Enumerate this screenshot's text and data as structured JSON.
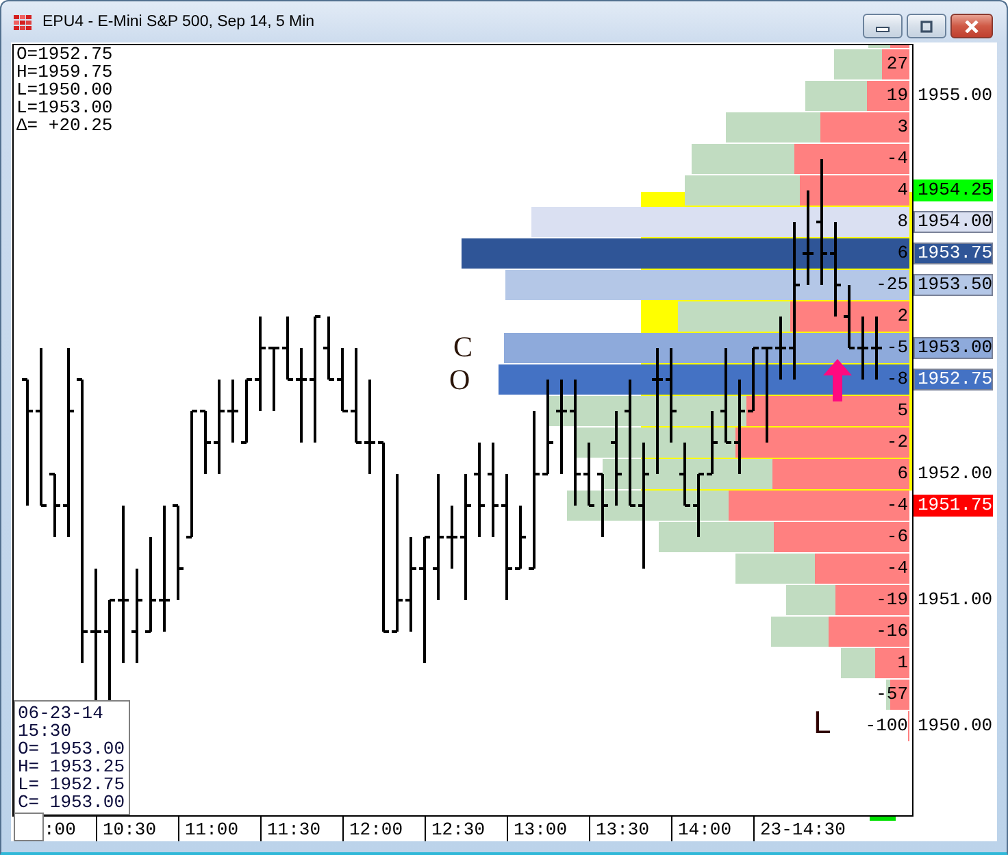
{
  "window": {
    "title": "EPU4 - E-Mini S&P 500, Sep 14, 5 Min"
  },
  "summary": [
    "O=1952.75",
    "H=1959.75",
    "L=1950.00",
    "L=1953.00",
    "Δ= +20.25"
  ],
  "ladder": [
    {
      "kind": "plain"
    },
    {
      "kind": "plain",
      "delta": "27"
    },
    {
      "kind": "plain",
      "delta": "19",
      "price": "1955.00"
    },
    {
      "kind": "plain",
      "delta": "3"
    },
    {
      "kind": "plain",
      "delta": "-4"
    },
    {
      "kind": "marker",
      "delta": "4",
      "price": "1954.25",
      "color": "#00ff00"
    },
    {
      "kind": "band",
      "delta": "8",
      "price": "1954.00",
      "color": "#dae0f2"
    },
    {
      "kind": "band",
      "delta": "6",
      "price": "1953.75",
      "color": "#2f5597"
    },
    {
      "kind": "band",
      "delta": "-25",
      "price": "1953.50",
      "color": "#b4c7e7"
    },
    {
      "kind": "plain",
      "delta": "2"
    },
    {
      "kind": "band",
      "delta": "-5",
      "price": "1953.00",
      "color": "#8eaadb"
    },
    {
      "kind": "band",
      "delta": "-8",
      "price": "1952.75",
      "color": "#4472c4"
    },
    {
      "kind": "plain",
      "delta": "5"
    },
    {
      "kind": "plain",
      "delta": "-2"
    },
    {
      "kind": "plain",
      "delta": "6",
      "price": "1952.00"
    },
    {
      "kind": "marker",
      "delta": "-4",
      "price": "1951.75",
      "color": "#ff0000"
    },
    {
      "kind": "plain",
      "delta": "-6"
    },
    {
      "kind": "plain",
      "delta": "-4"
    },
    {
      "kind": "plain",
      "delta": "-19",
      "price": "1951.00"
    },
    {
      "kind": "plain",
      "delta": "-16"
    },
    {
      "kind": "plain",
      "delta": "1"
    },
    {
      "kind": "plain",
      "delta": "-57"
    },
    {
      "kind": "plain",
      "delta": "-100",
      "price": "1950.00"
    }
  ],
  "annotations": [
    {
      "text": "C"
    },
    {
      "text": "O"
    },
    {
      "text": "L"
    }
  ],
  "bar_info": [
    "06-23-14",
    "15:30",
    "O= 1953.00",
    "H= 1953.25",
    "L= 1952.75",
    "C= 1953.00"
  ],
  "time_axis": [
    ":00",
    "10:30",
    "11:00",
    "11:30",
    "12:00",
    "12:30",
    "13:00",
    "13:30",
    "14:00",
    "23-14:30"
  ]
}
